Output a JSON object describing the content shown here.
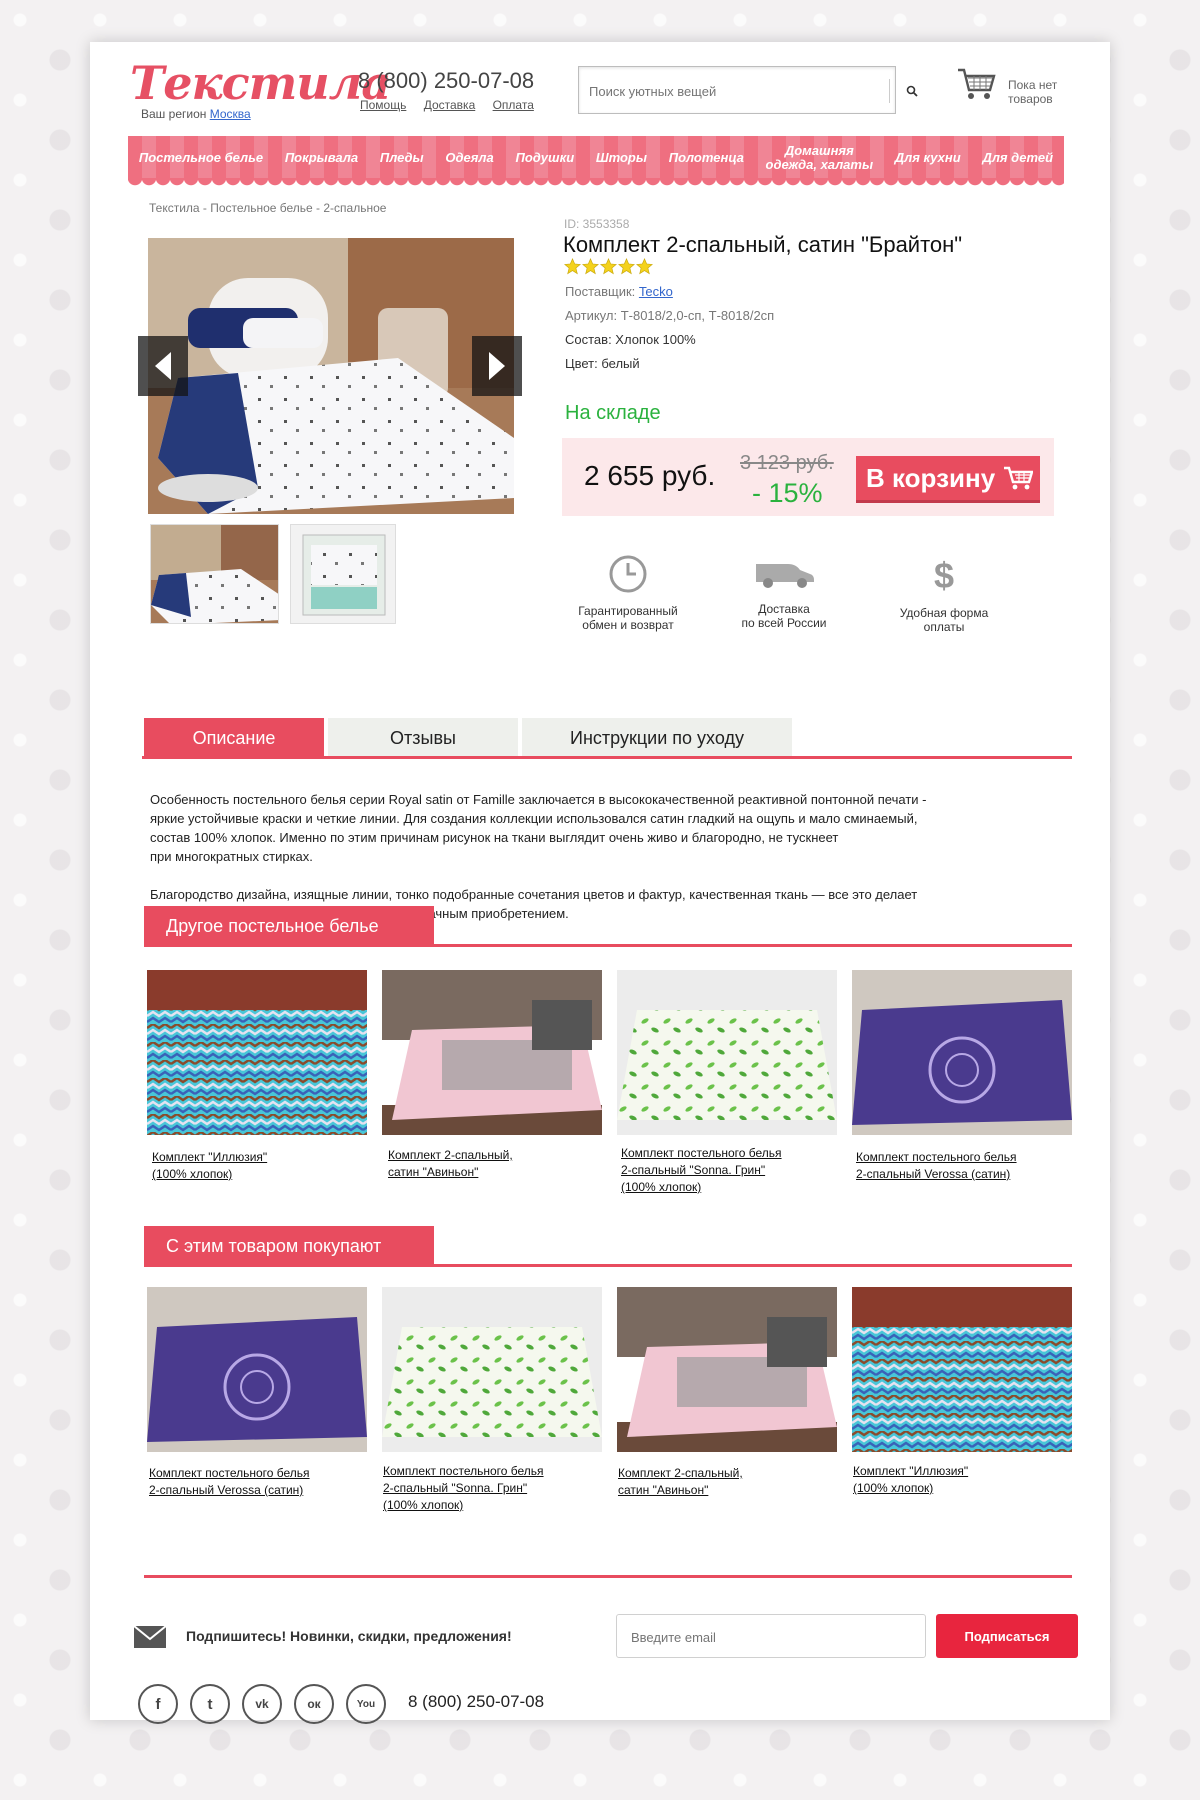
{
  "header": {
    "logo": "Текстила",
    "region_label": "Ваш регион",
    "region_value": "Москва",
    "phone": "8 (800) 250-07-08",
    "links": [
      "Помощь",
      "Доставка",
      "Оплата"
    ],
    "search_placeholder": "Поиск уютных вещей",
    "cart_line1": "Пока нет",
    "cart_line2": "товаров"
  },
  "nav": {
    "items": [
      {
        "line1": "Постельное белье",
        "line2": ""
      },
      {
        "line1": "Покрывала",
        "line2": ""
      },
      {
        "line1": "Пледы",
        "line2": ""
      },
      {
        "line1": "Одеяла",
        "line2": ""
      },
      {
        "line1": "Подушки",
        "line2": ""
      },
      {
        "line1": "Шторы",
        "line2": ""
      },
      {
        "line1": "Полотенца",
        "line2": ""
      },
      {
        "line1": "Домашняя",
        "line2": "одежда, халаты"
      },
      {
        "line1": "Для кухни",
        "line2": ""
      },
      {
        "line1": "Для детей",
        "line2": ""
      }
    ]
  },
  "breadcrumb": "Текстила - Постельное белье - 2-спальное",
  "product": {
    "id": "ID: 3553358",
    "title": "Комплект 2-спальный, сатин \"Брайтон\"",
    "rating": 5,
    "supplier_label": "Поставщик:",
    "supplier_value": "Tecko",
    "article": "Артикул: Т-8018/2,0-сп, Т-8018/2сп",
    "composition": "Состав: Хлопок 100%",
    "color": "Цвет: белый",
    "stock": "На складе",
    "price": "2 655 руб.",
    "old_price": "3 123 руб.",
    "discount": "- 15%",
    "cart_button": "В корзину"
  },
  "perks": [
    {
      "icon": "clock-icon",
      "line1": "Гарантированный",
      "line2": "обмен и возврат"
    },
    {
      "icon": "delivery-van-icon",
      "line1": "Доставка",
      "line2": "по всей России"
    },
    {
      "icon": "dollar-icon",
      "line1": "Удобная форма",
      "line2": "оплаты"
    }
  ],
  "tabs": [
    "Описание",
    "Отзывы",
    "Инструкции по уходу"
  ],
  "description": {
    "p1_l1": "Особенность постельного белья серии Royal satin от Famille заключается в высококачественной реактивной понтонной печати -",
    "p1_l2": "яркие устойчивые краски и четкие линии. Для создания коллекции использовался сатин гладкий на ощупь и мало сминаемый,",
    "p1_l3": "состав 100% хлопок. Именно по этим причинам рисунок на ткани выглядит очень живо и благородно, не тускнеет",
    "p1_l4": "при многократных стирках.",
    "p2_l1": "Благородство дизайна, изящные линии, тонко подобранные сочетания цветов и фактур, качественная ткань — все это делает",
    "p2_l2": "постельное белье Famille серии Royal satin удачным приобретением."
  },
  "section_other": {
    "title": "Другое постельное белье",
    "cards": [
      {
        "l1": "Комплект \"Иллюзия\"",
        "l2": "(100% хлопок)",
        "l3": ""
      },
      {
        "l1": "Комплект 2-спальный,",
        "l2": "сатин \"Авиньон\"",
        "l3": ""
      },
      {
        "l1": "Комплект постельного белья",
        "l2": "2-спальный \"Sonna. Грин\"",
        "l3": "(100% хлопок)"
      },
      {
        "l1": "Комплект постельного белья",
        "l2": "2-спальный Verossa (сатин)",
        "l3": ""
      }
    ]
  },
  "section_bought": {
    "title": "С этим товаром покупают",
    "cards": [
      {
        "l1": "Комплект постельного белья",
        "l2": "2-спальный Verossa (сатин)",
        "l3": ""
      },
      {
        "l1": "Комплект постельного белья",
        "l2": "2-спальный \"Sonna. Грин\"",
        "l3": "(100% хлопок)"
      },
      {
        "l1": "Комплект 2-спальный,",
        "l2": "сатин \"Авиньон\"",
        "l3": ""
      },
      {
        "l1": "Комплект \"Иллюзия\"",
        "l2": "(100% хлопок)",
        "l3": ""
      }
    ]
  },
  "footer": {
    "subscribe_text": "Подпишитесь! Новинки, скидки, предложения!",
    "email_placeholder": "Введите email",
    "subscribe_button": "Подписаться",
    "phone": "8 (800) 250-07-08",
    "social": [
      {
        "icon": "facebook-icon",
        "glyph": "f"
      },
      {
        "icon": "twitter-icon",
        "glyph": "t"
      },
      {
        "icon": "vk-icon",
        "glyph": "vk"
      },
      {
        "icon": "odnoklassniki-icon",
        "glyph": "ок"
      },
      {
        "icon": "youtube-icon",
        "glyph": "You"
      }
    ]
  },
  "colors": {
    "accent": "#e84c5f",
    "nav": "#ef6f80",
    "price_bg": "#fce8ea",
    "green": "#2ab23e",
    "link": "#3366cc"
  }
}
